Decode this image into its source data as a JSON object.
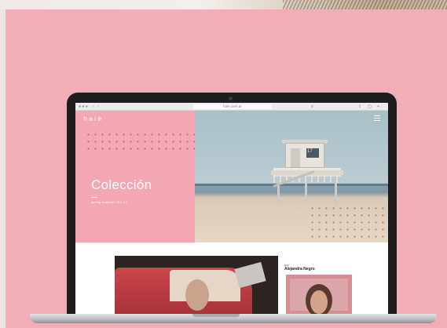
{
  "browser": {
    "back_icon": "chevron-left-icon",
    "url": "hale.com.ar",
    "reader_icon": "reader-icon",
    "share_icon": "share-icon",
    "tabs_icon": "tabs-icon"
  },
  "site": {
    "logo": "haie",
    "menu_icon": "hamburger-menu-icon",
    "heading": "Colección",
    "subheading": "spring summer 16 | 17",
    "tower_number": "17",
    "author_label": "por",
    "author_name": "Alejandra Negro"
  },
  "colors": {
    "poster_pink": "#f2aeb8",
    "site_pink": "#f2a7b3",
    "laptop_bezel": "#1d1d1f"
  }
}
